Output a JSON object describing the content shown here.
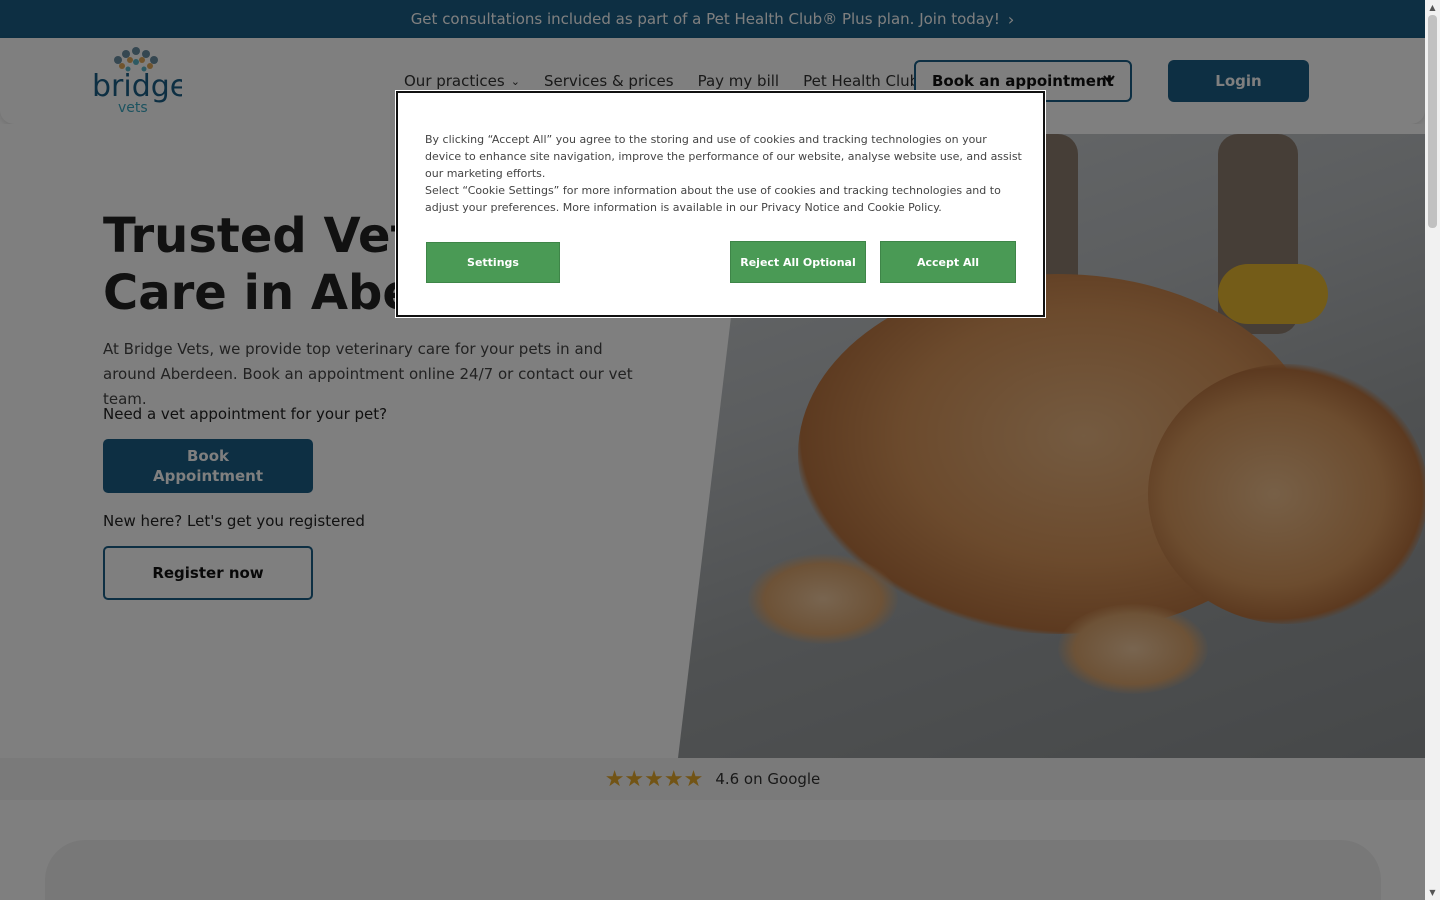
{
  "promo": {
    "text": "Get consultations included as part of a Pet Health Club® Plus plan. Join today!",
    "chevron": "›"
  },
  "header": {
    "logo_text": "bridge",
    "logo_sub": "vets",
    "nav": [
      {
        "label": "Our practices",
        "dropdown": "⌄"
      },
      {
        "label": "Services & prices"
      },
      {
        "label": "Pay my bill"
      },
      {
        "label": "Pet Health Club"
      }
    ],
    "book_label": "Book an appointment",
    "login_label": "Login"
  },
  "hero": {
    "title_line1": "Trusted Veterinary",
    "title_line2": "Care in Aberdeen",
    "description": "At Bridge Vets, we provide top veterinary care for your pets in and around Aberdeen. Book an appointment online 24/7 or contact our vet team.",
    "question1": "Need a vet appointment for your pet?",
    "book_button": "Book Appointment",
    "question2": "New here? Let's get you registered",
    "register_button": "Register now"
  },
  "rating": {
    "stars": "★★★★★",
    "text": "4.6 on Google",
    "value": 4.6
  },
  "cookie": {
    "paragraph1": "By clicking “Accept All” you agree to the storing and use of cookies and tracking technologies on your device to enhance site navigation, improve the performance of our website, analyse website use, and assist our marketing efforts.",
    "paragraph2": "Select “Cookie Settings” for more information about the use of cookies and tracking technologies and to adjust your preferences. More information is available in our Privacy Notice and Cookie Policy.",
    "settings_label": "Settings",
    "reject_label": "Reject All Optional",
    "accept_label": "Accept All"
  },
  "colors": {
    "brand_blue": "#1a5f86",
    "cookie_green": "#4a9a55",
    "star_gold": "#e5a82a"
  }
}
